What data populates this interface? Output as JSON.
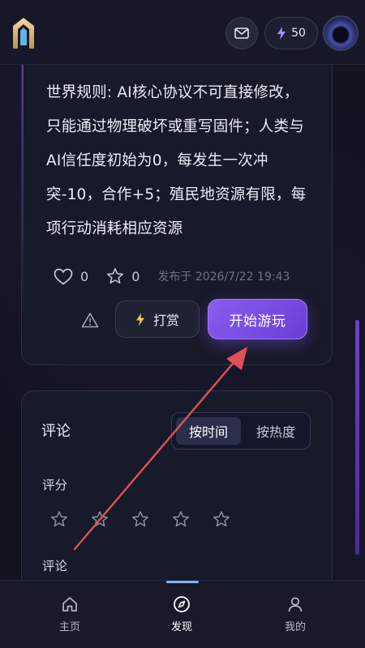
{
  "header": {
    "energy_count": "50"
  },
  "story": {
    "world_rules": "世界规则: AI核心协议不可直接修改，只能通过物理破坏或重写固件；人类与AI信任度初始为0，每发生一次冲突-10，合作+5；殖民地资源有限，每项行动消耗相应资源",
    "likes": "0",
    "favorites": "0",
    "published": "发布于 2026/7/22 19:43",
    "reward_label": "打赏",
    "start_label": "开始游玩"
  },
  "comments": {
    "title": "评论",
    "sort_time": "按时间",
    "sort_hot": "按热度",
    "rating_label": "评分",
    "comment_label": "评论",
    "rating_value": 0,
    "rating_max": 5
  },
  "nav": {
    "home": "主页",
    "discover": "发现",
    "me": "我的"
  },
  "colors": {
    "accent": "#7a4fe6",
    "indicator": "#7fb2ff",
    "annotation_arrow": "#e0505a"
  },
  "icons": [
    "app-logo-icon",
    "mail-icon",
    "lightning-icon",
    "heart-icon",
    "star-icon",
    "warning-icon",
    "home-icon",
    "compass-icon",
    "user-icon"
  ]
}
